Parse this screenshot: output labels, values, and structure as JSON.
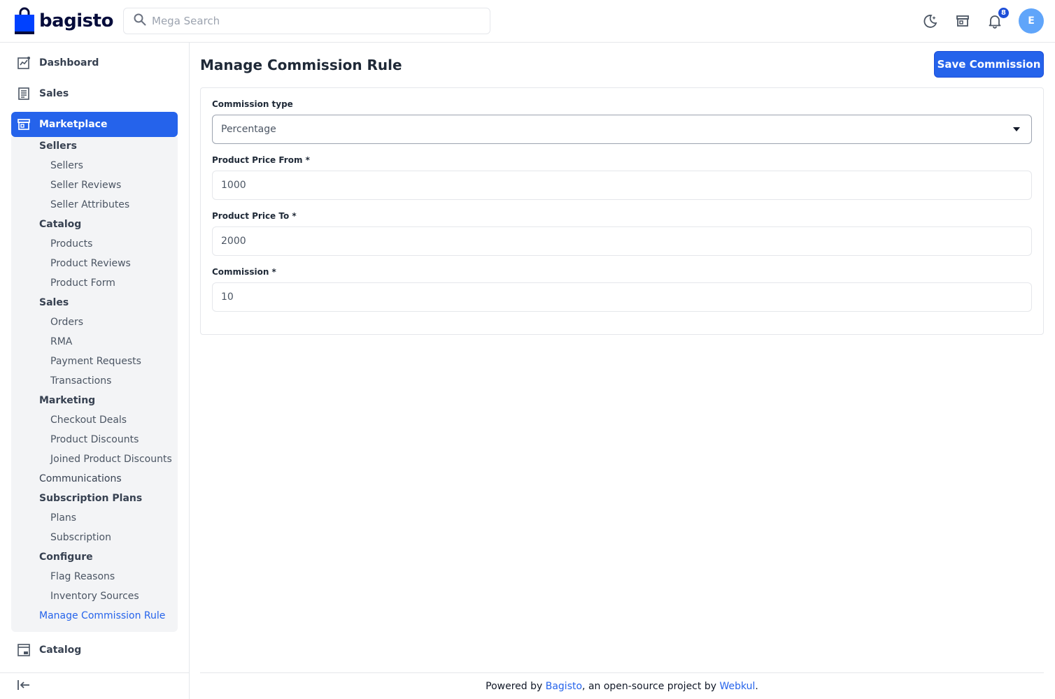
{
  "brand": {
    "name": "bagisto"
  },
  "search": {
    "placeholder": "Mega Search"
  },
  "header": {
    "notification_count": "8",
    "avatar_initial": "E"
  },
  "sidebar": {
    "dashboard": "Dashboard",
    "sales": "Sales",
    "marketplace": "Marketplace",
    "catalog": "Catalog",
    "submenu": [
      {
        "label": "Sellers",
        "type": "group"
      },
      {
        "label": "Sellers",
        "type": "leaf"
      },
      {
        "label": "Seller Reviews",
        "type": "leaf"
      },
      {
        "label": "Seller Attributes",
        "type": "leaf"
      },
      {
        "label": "Catalog",
        "type": "group"
      },
      {
        "label": "Products",
        "type": "leaf"
      },
      {
        "label": "Product Reviews",
        "type": "leaf"
      },
      {
        "label": "Product Form",
        "type": "leaf"
      },
      {
        "label": "Sales",
        "type": "group"
      },
      {
        "label": "Orders",
        "type": "leaf"
      },
      {
        "label": "RMA",
        "type": "leaf"
      },
      {
        "label": "Payment Requests",
        "type": "leaf"
      },
      {
        "label": "Transactions",
        "type": "leaf"
      },
      {
        "label": "Marketing",
        "type": "group"
      },
      {
        "label": "Checkout Deals",
        "type": "leaf"
      },
      {
        "label": "Product Discounts",
        "type": "leaf"
      },
      {
        "label": "Joined Product Discounts",
        "type": "leaf"
      },
      {
        "label": "Communications",
        "type": "plain"
      },
      {
        "label": "Subscription Plans",
        "type": "group"
      },
      {
        "label": "Plans",
        "type": "leaf"
      },
      {
        "label": "Subscription",
        "type": "leaf"
      },
      {
        "label": "Configure",
        "type": "group"
      },
      {
        "label": "Flag Reasons",
        "type": "leaf"
      },
      {
        "label": "Inventory Sources",
        "type": "leaf"
      },
      {
        "label": "Manage Commission Rule",
        "type": "current"
      }
    ]
  },
  "page": {
    "title": "Manage Commission Rule",
    "save_label": "Save Commission"
  },
  "form": {
    "commission_type_label": "Commission type",
    "commission_type_value": "Percentage",
    "price_from_label": "Product Price From",
    "price_from_value": "1000",
    "price_to_label": "Product Price To",
    "price_to_value": "2000",
    "commission_label": "Commission",
    "commission_value": "10",
    "required_mark": "*"
  },
  "footer": {
    "prefix": "Powered by ",
    "bagisto_link": "Bagisto",
    "middle": ", an open-source project by ",
    "webkul_link": "Webkul",
    "suffix": "."
  },
  "colors": {
    "accent": "#2563eb",
    "submenu_bg": "#f3f4f6"
  }
}
